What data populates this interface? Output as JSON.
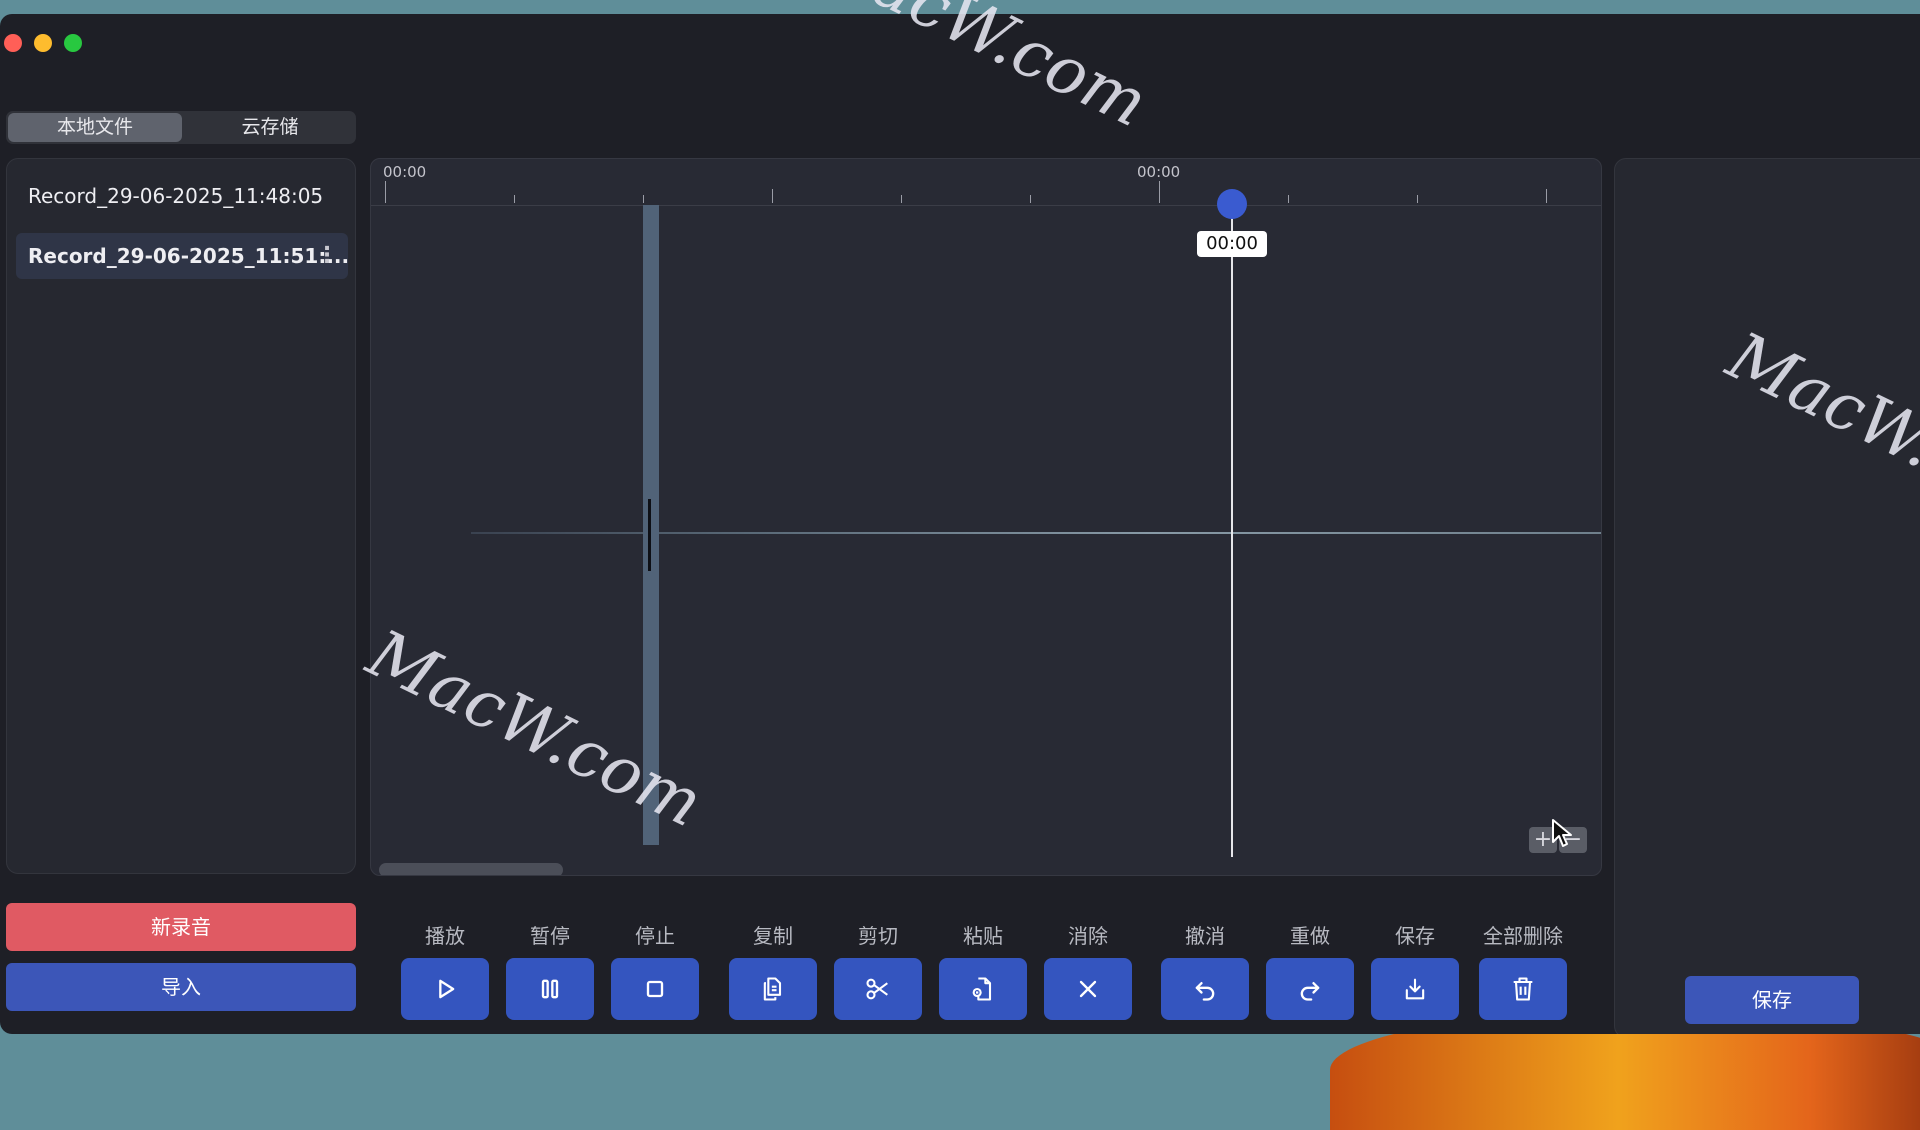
{
  "tabs": [
    {
      "label": "本地文件",
      "active": true
    },
    {
      "label": "云存储",
      "active": false
    }
  ],
  "files": [
    {
      "name": "Record_29-06-2025_11:48:05",
      "selected": false
    },
    {
      "name": "Record_29-06-2025_11:51:...",
      "selected": true
    }
  ],
  "sidebar": {
    "new_record_label": "新录音",
    "import_label": "导入"
  },
  "timeline": {
    "start_label": "00:00",
    "mid_label": "00:00",
    "playhead_time": "00:00",
    "zoom_in_label": "+",
    "zoom_out_label": "−"
  },
  "toolbar": [
    {
      "id": "play",
      "label": "播放",
      "icon": "play-icon"
    },
    {
      "id": "pause",
      "label": "暂停",
      "icon": "pause-icon"
    },
    {
      "id": "stop",
      "label": "停止",
      "icon": "stop-icon"
    },
    {
      "id": "copy",
      "label": "复制",
      "icon": "copy-icon"
    },
    {
      "id": "cut",
      "label": "剪切",
      "icon": "scissors-icon"
    },
    {
      "id": "paste",
      "label": "粘贴",
      "icon": "paste-icon"
    },
    {
      "id": "clear",
      "label": "消除",
      "icon": "x-icon"
    },
    {
      "id": "undo",
      "label": "撤消",
      "icon": "undo-icon"
    },
    {
      "id": "redo",
      "label": "重做",
      "icon": "redo-icon"
    },
    {
      "id": "save",
      "label": "保存",
      "icon": "download-icon"
    },
    {
      "id": "delete_all",
      "label": "全部删除",
      "icon": "trash-icon"
    }
  ],
  "right_panel": {
    "save_label": "保存"
  },
  "watermarks": [
    "MacW.com",
    "MacW.com",
    "MacW.c"
  ],
  "colors": {
    "window_bg": "#1e1f26",
    "accent_blue": "#3455bf",
    "record_red": "#e05a63",
    "playhead_blue": "#3a5bd0"
  }
}
